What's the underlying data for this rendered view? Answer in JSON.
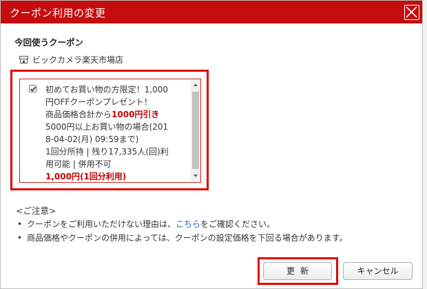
{
  "dialog": {
    "title": "クーポン利用の変更",
    "close_label": "×"
  },
  "current": {
    "heading": "今回使うクーポン",
    "shop_icon": "shop-icon",
    "shop_name": "ビックカメラ楽天市場店"
  },
  "coupon": {
    "checked": true,
    "line1": "初めてお買い物の方限定！1,000",
    "line2": "円OFFクーポンプレゼント！",
    "line3_prefix": "商品価格合計から",
    "line3_highlight": "1000円引き",
    "line4": "5000円以上お買い物の場合(201",
    "line5": "8-04-02(月) 09:59まで)",
    "line6": "1回分所持 | 残り17,335人(回)利",
    "line7": "用可能 | 併用不可",
    "line8": "1,000円(1回分利用)"
  },
  "notice": {
    "heading": "<ご注意>",
    "item1_prefix": "クーポンをご利用いただけない理由は、",
    "item1_link": "こちら",
    "item1_suffix": "をご確認ください。",
    "item2": "商品価格やクーポンの併用によっては、クーポンの設定価格を下回る場合があります。"
  },
  "buttons": {
    "update": "更新",
    "cancel": "キャンセル"
  },
  "colors": {
    "title_bar": "#c50d0d",
    "highlight_frame": "#e10000",
    "link": "#2364b2",
    "emphasis": "#c40000"
  }
}
